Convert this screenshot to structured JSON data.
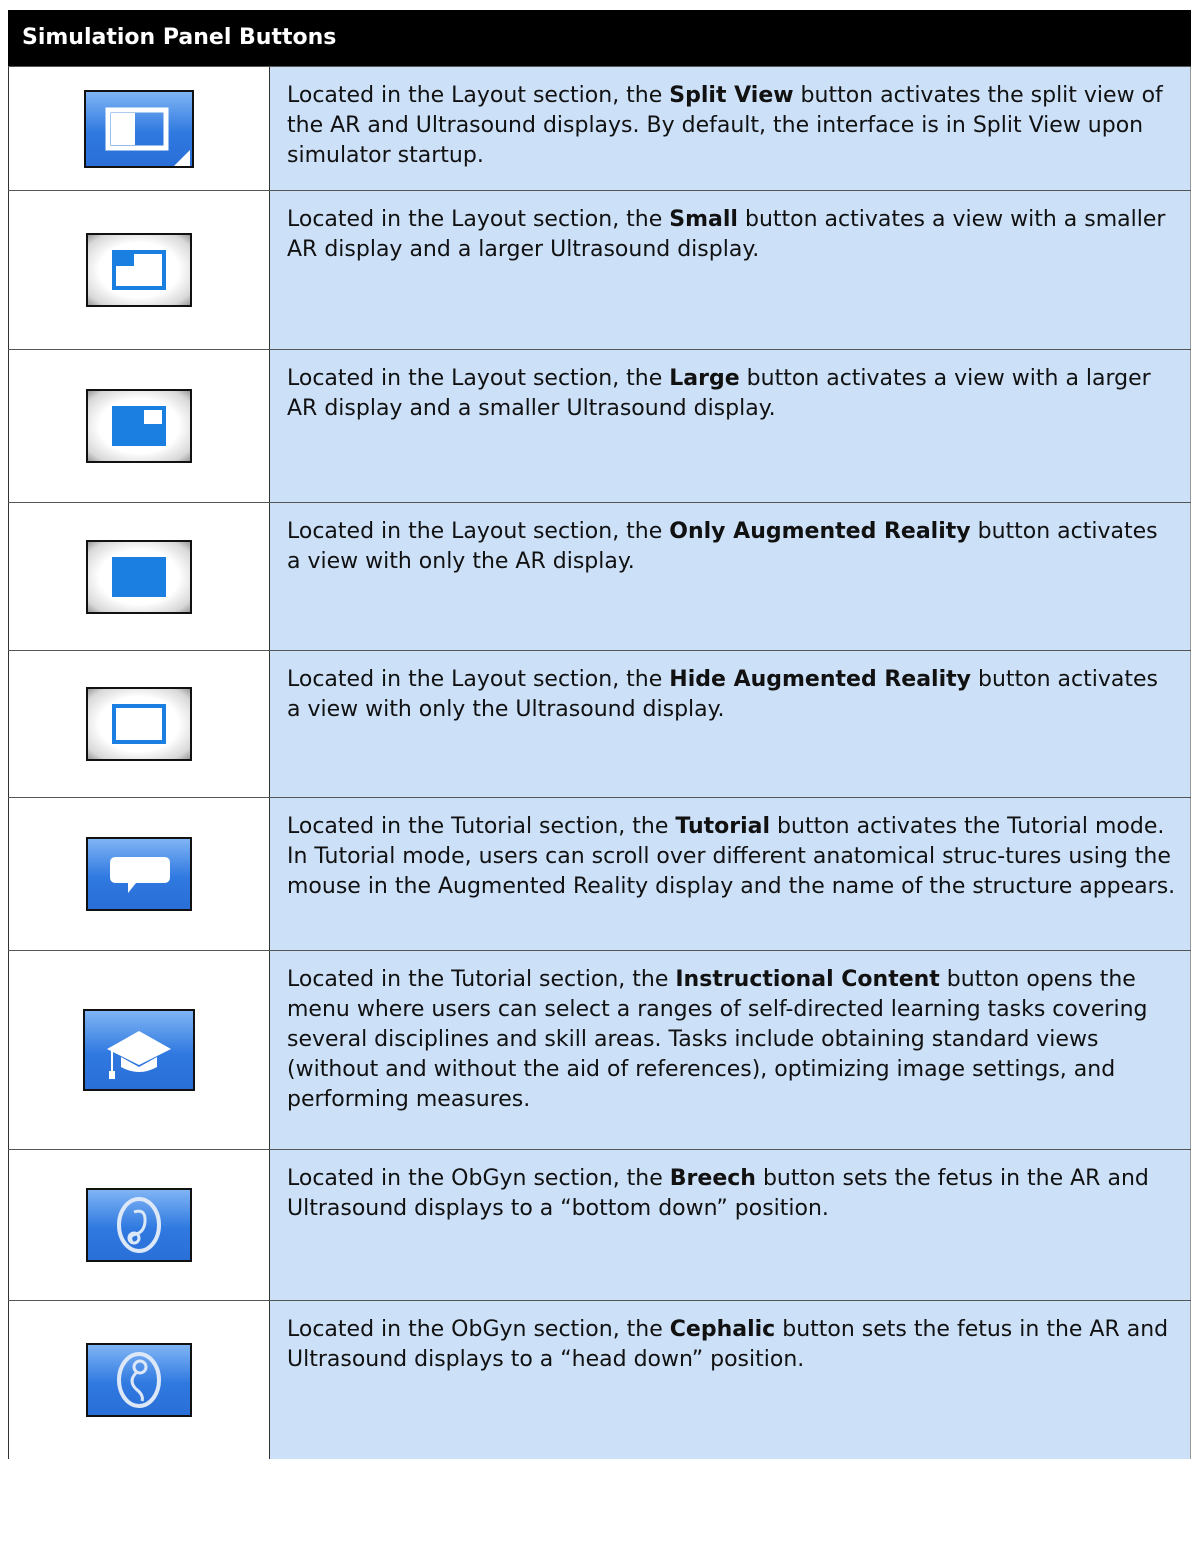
{
  "header": {
    "title": "Simulation Panel Buttons"
  },
  "rows": [
    {
      "icon": "split-view-icon",
      "pre": "Located in the Layout section, the ",
      "bold": "Split View",
      "post": " button activates the split view of the AR and Ultrasound displays. By default, the interface is in Split View upon simulator startup."
    },
    {
      "icon": "small-layout-icon",
      "pre": "Located in the Layout section, the ",
      "bold": "Small",
      "post": " button activates a view with a smaller AR display and a larger Ultrasound display."
    },
    {
      "icon": "large-layout-icon",
      "pre": "Located in the Layout section, the ",
      "bold": "Large",
      "post": " button activates a view with a larger AR display and a smaller Ultrasound display."
    },
    {
      "icon": "only-ar-icon",
      "pre": "Located in the Layout section, the ",
      "bold": "Only Augmented Reality",
      "post": " button activates a view with only the AR display."
    },
    {
      "icon": "hide-ar-icon",
      "pre": "Located in the Layout section, the ",
      "bold": "Hide Augmented Reality",
      "post": " button activates a view with only the Ultrasound display."
    },
    {
      "icon": "tutorial-speech-bubble-icon",
      "pre": "Located in the Tutorial section, the ",
      "bold": "Tutorial",
      "post": " button activates the Tutorial mode. In Tutorial mode, users can scroll over different anatomical struc-tures using the mouse in the Augmented Reality display and the name of the structure appears."
    },
    {
      "icon": "graduation-cap-icon",
      "pre": "Located in the Tutorial section, the ",
      "bold": "Instructional Content",
      "post": " button opens the menu where users can select a ranges of self-directed learning tasks covering several disciplines and skill areas. Tasks include obtaining standard views (without and without the aid of references), optimizing image settings, and performing measures."
    },
    {
      "icon": "breech-fetus-icon",
      "pre": "Located in the ObGyn section, the ",
      "bold": "Breech",
      "post": " button sets the fetus in the AR and Ultrasound displays to a “bottom down” position."
    },
    {
      "icon": "cephalic-fetus-icon",
      "pre": "Located in the ObGyn section, the ",
      "bold": "Cephalic",
      "post": " button sets the fetus in the AR and Ultrasound displays to a “head down” position."
    }
  ]
}
